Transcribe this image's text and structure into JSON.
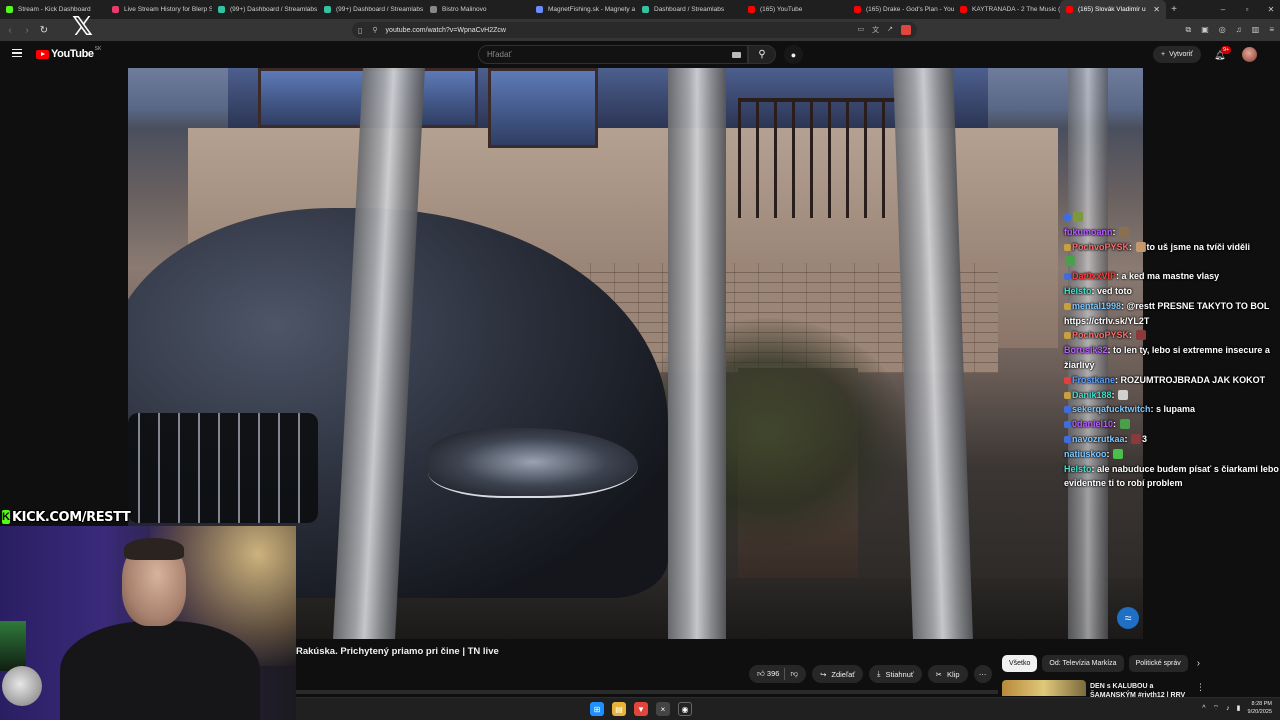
{
  "browser": {
    "tabs": [
      {
        "title": "Stream - Kick Dashboard",
        "color": "#53fc18"
      },
      {
        "title": "Live Stream History for Blerp S",
        "color": "#e83a6b"
      },
      {
        "title": "(99+) Dashboard / Streamlabs",
        "color": "#31c3a2"
      },
      {
        "title": "(99+) Dashboard / Streamlabs",
        "color": "#31c3a2"
      },
      {
        "title": "Bistro Malinovo",
        "color": "#888888"
      },
      {
        "title": "MagnetFishing.sk - Magnety a",
        "color": "#6a8cff"
      },
      {
        "title": "Dashboard / Streamlabs",
        "color": "#31c3a2"
      },
      {
        "title": "(165) YouTube",
        "color": "#ff0000"
      },
      {
        "title": "(165) Drake - God's Plan - YouT",
        "color": "#ff0000"
      },
      {
        "title": "KAYTRANADA - 2 The Music (",
        "color": "#ff0000"
      },
      {
        "title": "(165) Slovák Vladimír u",
        "color": "#ff0000"
      }
    ],
    "url": "youtube.com/watch?v=WpnaCvH2Zcw"
  },
  "youtube": {
    "logo_text": "YouTube",
    "region": "SK",
    "search_placeholder": "Hľadať",
    "create_label": "Vytvoriť",
    "notification_count": "9+"
  },
  "video": {
    "title": "Rakúska. Prichytený priamo pri čine | TN live",
    "likes": "396",
    "share_label": "Zdieľať",
    "download_label": "Stiahnuť",
    "clip_label": "Klip"
  },
  "overlay": {
    "kick_url": "KICK.COM/RESTT"
  },
  "chat": [
    {
      "user": "",
      "user_color": "#e05a9a",
      "badge": "#3f6de0",
      "text": "",
      "emote": "#7c9a3a"
    },
    {
      "user": "fukumoann",
      "user_color": "#b85cff",
      "badge": "",
      "text": "",
      "emote": "#8a7050"
    },
    {
      "user": "PochvoPYSK",
      "user_color": "#ff6a6a",
      "badge": "#c8a040",
      "text": "to uš jsme na tvíči viděli",
      "emote": "#c49a6c"
    },
    {
      "user": "",
      "user_color": "#ffffff",
      "badge": "",
      "text": "",
      "emote": "#4aa04a"
    },
    {
      "user": "Dat0xxVIP",
      "user_color": "#ff3b3b",
      "badge": "#3f6de0",
      "text": "a ked ma mastne vlasy",
      "emote": ""
    },
    {
      "user": "Helsto",
      "user_color": "#40e0d0",
      "badge": "",
      "text": "ved toto",
      "emote": ""
    },
    {
      "user": "mental1998",
      "user_color": "#7ec8ff",
      "badge": "#c8a040",
      "text": "@restt PRESNE TAKYTO TO BOL https://ctrlv.sk/YL2T",
      "emote": ""
    },
    {
      "user": "PochvoPYSK",
      "user_color": "#ff6a6a",
      "badge": "#c8a040",
      "text": "",
      "emote": "#8a3a3a"
    },
    {
      "user": "Borusik32",
      "user_color": "#b85cff",
      "badge": "",
      "text": "to len ty, lebo si extremne insecure a žiarlivý",
      "emote": ""
    },
    {
      "user": "Frostkane",
      "user_color": "#5aa0ff",
      "badge": "#e04040",
      "text": "ROZUMTROJBRADA JAK KOKOT",
      "emote": ""
    },
    {
      "user": "Danik188",
      "user_color": "#40e0d0",
      "badge": "#c8a040",
      "text": "",
      "emote": "#d0d0d0"
    },
    {
      "user": "sekerqafucktwitch",
      "user_color": "#7ec8ff",
      "badge": "#3f6de0",
      "text": "s lupama",
      "emote": ""
    },
    {
      "user": "0daniel10",
      "user_color": "#b85cff",
      "badge": "#3f6de0",
      "text": "",
      "emote": "#4aa04a"
    },
    {
      "user": "navozrutkaa",
      "user_color": "#7ec8ff",
      "badge": "#3f6de0",
      "text": "3",
      "emote": "#8a3a3a"
    },
    {
      "user": "natiuskoo",
      "user_color": "#7ec8ff",
      "badge": "",
      "text": "",
      "emote": "#4ac04a"
    },
    {
      "user": "Helsto",
      "user_color": "#40e0d0",
      "badge": "",
      "text": "ale nabuduce budem písať s čiarkami lebo evidentne ti to robí problem",
      "emote": ""
    }
  ],
  "sidebar_chips": [
    "Všetko",
    "Od: Televízia Markíza",
    "Politické správ"
  ],
  "recommendation": {
    "title": "DEN s KALUBOU a ŠAMANSKÝM #rivth12 | RRV"
  },
  "taskbar": {
    "time": "8:28 PM",
    "date": "9/20/2025"
  },
  "colors": {
    "youtube_red": "#ff0000",
    "kick_green": "#53fc18",
    "page_bg": "#0f0f0f"
  }
}
